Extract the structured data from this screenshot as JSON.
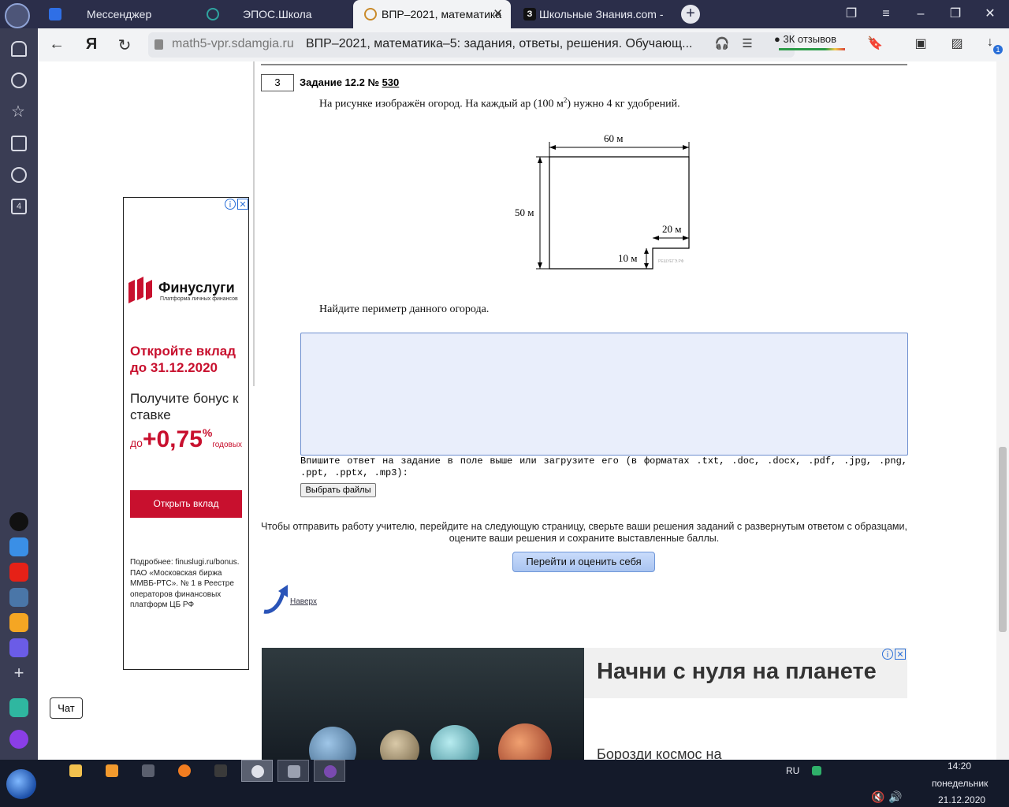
{
  "tabs": [
    {
      "label": "Мессенджер"
    },
    {
      "label": "ЭПОС.Школа"
    },
    {
      "label": "ВПР–2021, математика"
    },
    {
      "label": "Школьные Знания.com - "
    }
  ],
  "address": {
    "domain": "math5-vpr.sdamgia.ru",
    "title": "ВПР–2021, математика–5: задания, ответы, решения. Обучающ...",
    "reviews": "3К отзывов",
    "downloads_badge": "1"
  },
  "sidebar": {
    "badge": "4"
  },
  "chat_label": "Чат",
  "left_ad": {
    "brand": "Финуслуги",
    "brand_sub": "Платформа личных финансов",
    "headline": "Откройте вклад до 31.12.2020",
    "sub": "Получите бонус к ставке",
    "rate_prefix": "до",
    "rate": "+0,75",
    "rate_pct": "%",
    "rate_suffix": "годовых",
    "button": "Открыть вклад",
    "footer": "Подробнее: finuslugi.ru/bonus. ПАО «Московская биржа ММВБ-РТС». № 1 в Реестре операторов финансовых платформ ЦБ РФ"
  },
  "task": {
    "number": "3",
    "title": "Задание 12.2 №",
    "link": "530",
    "text_a": "На рисунке изображён огород. На каждый ар (100 м",
    "text_sup": "2",
    "text_b": ") нужно 4 кг удобрений.",
    "question": "Найдите периметр данного огорода.",
    "figure": {
      "top": "60 м",
      "left": "50 м",
      "notch_w": "20 м",
      "notch_h": "10 м",
      "watermark": "РЕШУЕГЭ.РФ"
    }
  },
  "answer_hint": "Впишите ответ на задание в поле выше или загрузите его (в форматах .txt, .doc, .docx, .pdf, .jpg, .png, .ppt, .pptx, .mp3):",
  "file_button": "Выбрать файлы",
  "send_text": "Чтобы отправить работу учителю, перейдите на следующую страницу, сверьте ваши решения заданий с развернутым ответом с образцами, оцените ваши решения и сохраните выставленные баллы.",
  "send_button": "Перейти и оценить себя",
  "top_link": "Наверх",
  "bottom_ad": {
    "headline": "Начни с нуля на планете",
    "sub": "Борозди космос на"
  },
  "taskbar": {
    "lang": "RU",
    "time": "14:20",
    "day": "понедельник",
    "date": "21.12.2020"
  }
}
